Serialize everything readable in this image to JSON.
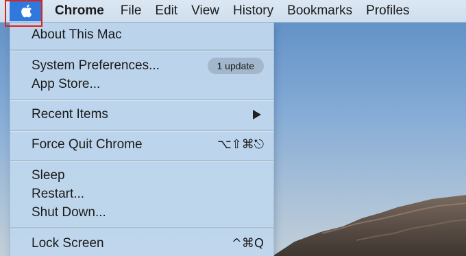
{
  "menubar": {
    "apple_icon": "apple-logo-icon",
    "items": [
      {
        "label": "Chrome",
        "is_app": true
      },
      {
        "label": "File"
      },
      {
        "label": "Edit"
      },
      {
        "label": "View"
      },
      {
        "label": "History"
      },
      {
        "label": "Bookmarks"
      },
      {
        "label": "Profiles"
      }
    ]
  },
  "apple_menu": {
    "about": {
      "label": "About This Mac"
    },
    "system_preferences": {
      "label": "System Preferences...",
      "badge": "1 update"
    },
    "app_store": {
      "label": "App Store..."
    },
    "recent_items": {
      "label": "Recent Items",
      "submenu_icon": "triangle-right-icon"
    },
    "force_quit": {
      "label": "Force Quit Chrome",
      "shortcut": "⌥⇧⌘⎋"
    },
    "sleep": {
      "label": "Sleep"
    },
    "restart": {
      "label": "Restart..."
    },
    "shut_down": {
      "label": "Shut Down..."
    },
    "lock_screen": {
      "label": "Lock Screen",
      "shortcut": "^⌘Q"
    }
  },
  "colors": {
    "highlight_box": "#e0201a",
    "active_menu": "#2f78dc",
    "menu_bg": "#bed6ec",
    "badge_bg": "#a3b7cc"
  }
}
